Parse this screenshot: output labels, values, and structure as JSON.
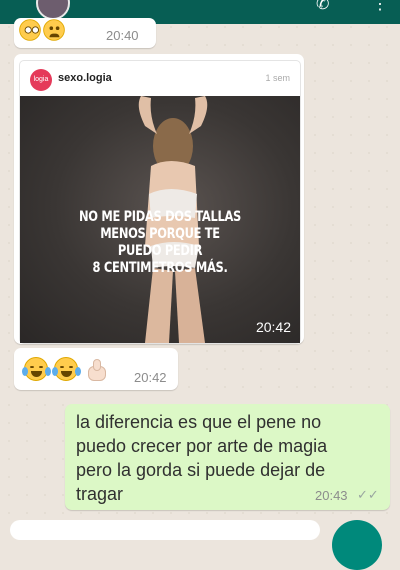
{
  "messages": {
    "first": {
      "time": "20:40"
    },
    "post": {
      "brand": "sexo.logia",
      "logo_text": "logia",
      "age": "1 sem",
      "caption": [
        "NO ME PIDAS DOS TALLAS",
        "MENOS PORQUE TE PUEDO PEDIR",
        "8 CENTIMETROS MÁS."
      ],
      "time": "20:42"
    },
    "reaction": {
      "time": "20:42"
    },
    "outgoing": {
      "text": "la diferencia es que el pene no puedo crecer por arte de magia pero la gorda si puede dejar de tragar",
      "time": "20:43",
      "status": "✓✓"
    }
  },
  "colors": {
    "header": "#075e54",
    "incoming": "#ffffff",
    "outgoing": "#dcf8c6",
    "background": "#ece5dd"
  }
}
